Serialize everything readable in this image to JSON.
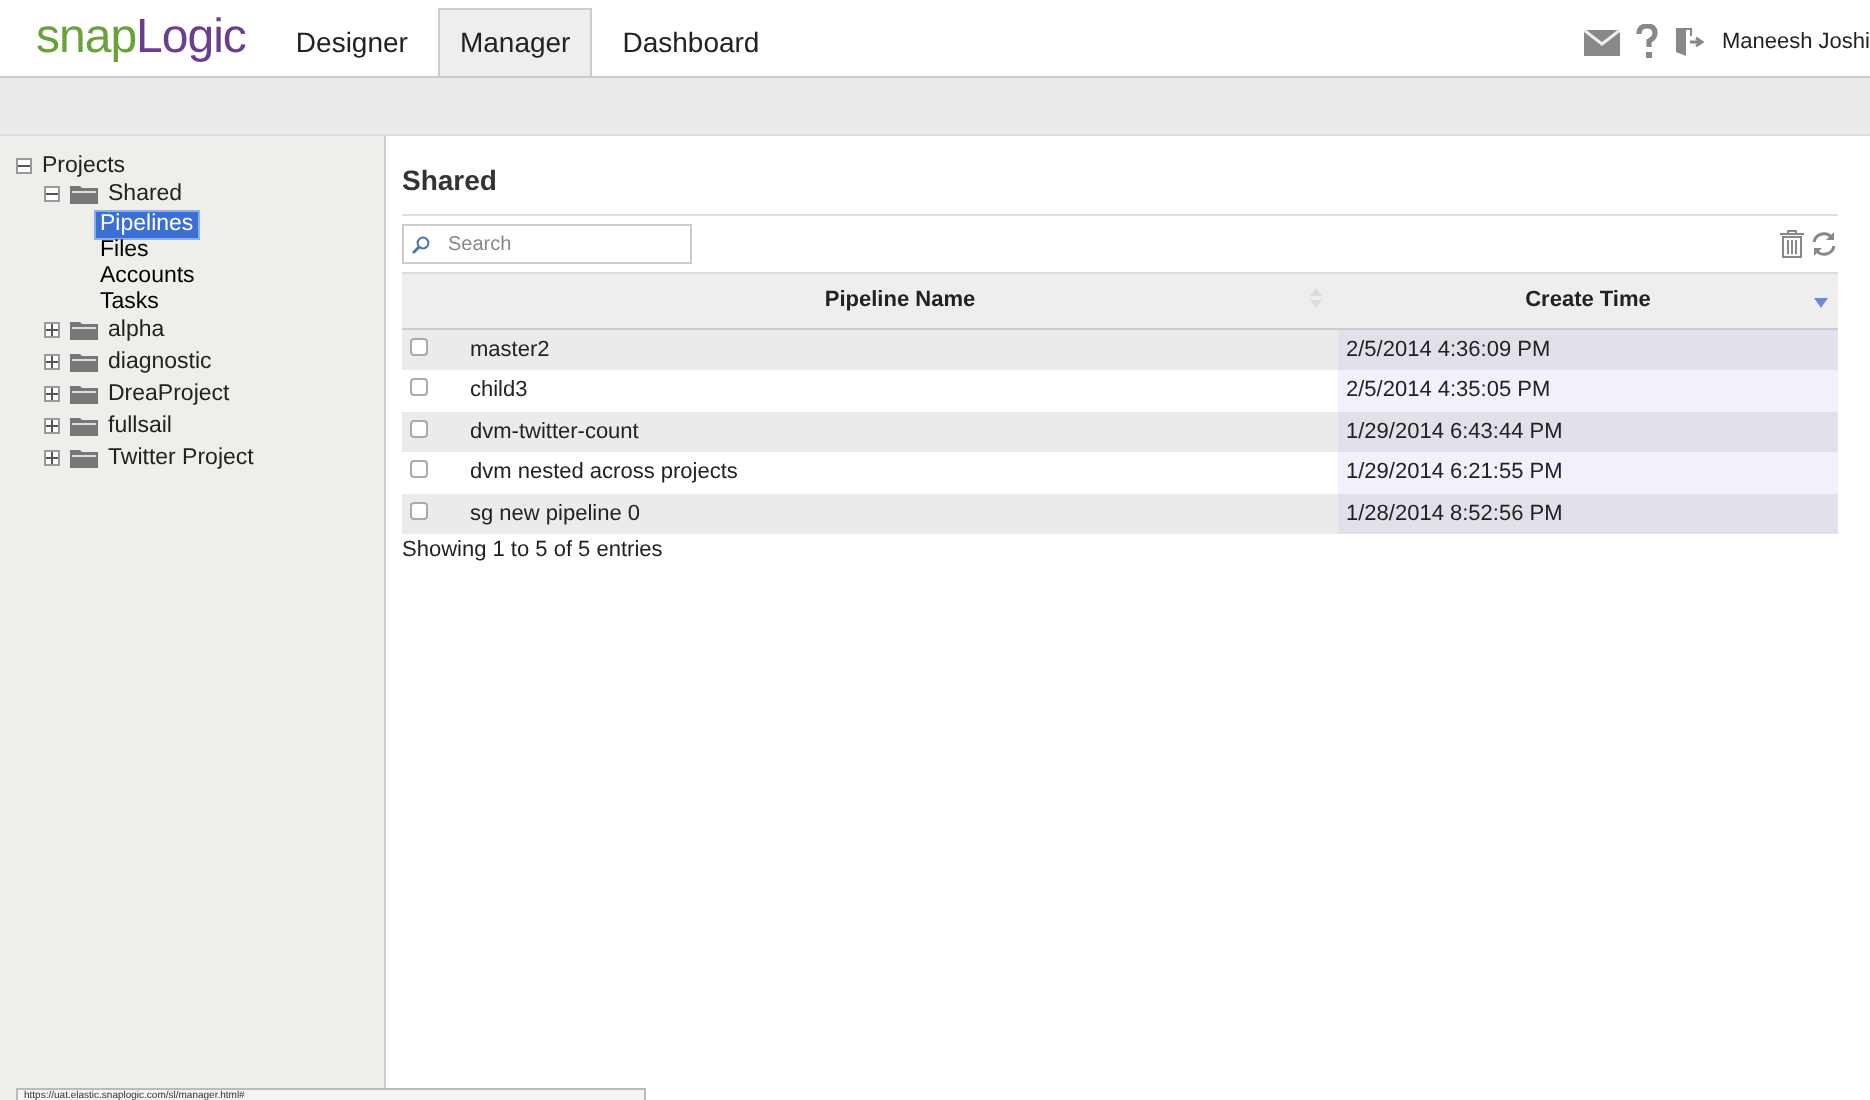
{
  "logo": {
    "part_1": "snap",
    "part_2": "Logic"
  },
  "tabs": [
    {
      "label": "Designer",
      "selected": false
    },
    {
      "label": "Manager",
      "selected": true
    },
    {
      "label": "Dashboard",
      "selected": false
    }
  ],
  "user": {
    "name": "Maneesh Joshi"
  },
  "tree": [
    {
      "label": "Projects",
      "kind": "root",
      "expanded": true,
      "children": [
        {
          "label": "Shared",
          "kind": "folder",
          "expanded": true,
          "children": [
            {
              "label": "Pipelines",
              "kind": "leaf",
              "selected": true
            },
            {
              "label": "Files",
              "kind": "leaf",
              "selected": false
            },
            {
              "label": "Accounts",
              "kind": "leaf",
              "selected": false
            },
            {
              "label": "Tasks",
              "kind": "leaf",
              "selected": false
            }
          ]
        },
        {
          "label": "alpha",
          "kind": "folder",
          "expanded": false
        },
        {
          "label": "diagnostic",
          "kind": "folder",
          "expanded": false
        },
        {
          "label": "DreaProject",
          "kind": "folder",
          "expanded": false
        },
        {
          "label": "fullsail",
          "kind": "folder",
          "expanded": false
        },
        {
          "label": "Twitter Project",
          "kind": "folder",
          "expanded": false
        }
      ]
    }
  ],
  "panel": {
    "title": "Shared",
    "search": {
      "placeholder": "Search"
    }
  },
  "table": {
    "columns": [
      {
        "label": "Pipeline Name",
        "sorted": false
      },
      {
        "label": "Create Time",
        "sorted": true
      }
    ],
    "rows": [
      {
        "checked": false,
        "name": "master2",
        "time": "2/5/2014 4:36:09 PM"
      },
      {
        "checked": false,
        "name": "child3",
        "time": "2/5/2014 4:35:05 PM"
      },
      {
        "checked": false,
        "name": "dvm-twitter-count",
        "time": "1/29/2014 6:43:44 PM"
      },
      {
        "checked": false,
        "name": "dvm nested across projects",
        "time": "1/29/2014 6:21:55 PM"
      },
      {
        "checked": false,
        "name": "sg new pipeline 0",
        "time": "1/28/2014 8:52:56 PM"
      }
    ]
  },
  "info": "Showing 1 to 5 of 5 entries",
  "status_url": "https://uat.elastic.snaplogic.com/sl/manager.html#"
}
